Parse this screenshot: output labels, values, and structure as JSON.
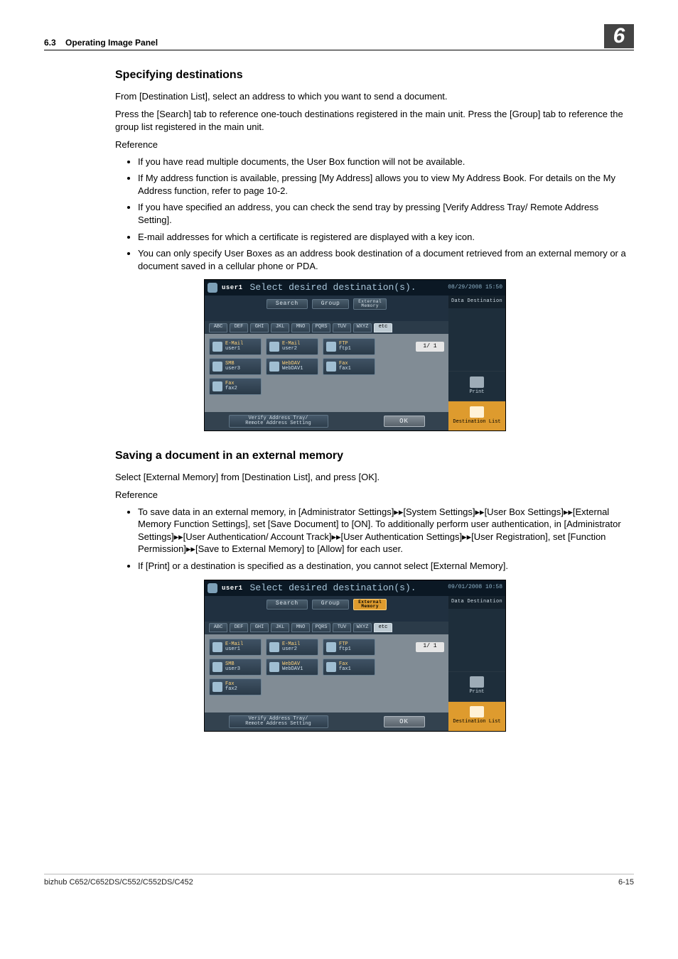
{
  "header": {
    "section_num": "6.3",
    "section_title": "Operating Image Panel",
    "chapter_num": "6"
  },
  "sec1": {
    "heading": "Specifying destinations",
    "p1": "From [Destination List], select an address to which you want to send a document.",
    "p2": "Press the [Search] tab to reference one-touch destinations registered in the main unit. Press the [Group] tab to reference the group list registered in the main unit.",
    "ref": "Reference",
    "bullets": [
      "If you have read multiple documents, the User Box function will not be available.",
      "If My address function is available, pressing [My Address] allows you to view My Address Book. For details on the My Address function, refer to page 10-2.",
      "If you have specified an address, you can check the send tray by pressing [Verify Address Tray/ Remote Address Setting].",
      "E-mail addresses for which a certificate is registered are displayed with a key icon.",
      "You can only specify User Boxes as an address book destination of a document retrieved from an external memory or a document saved in a cellular phone or PDA."
    ]
  },
  "sec2": {
    "heading": "Saving a document in an external memory",
    "p1": "Select [External Memory] from [Destination List], and press [OK].",
    "ref": "Reference",
    "bullets": [
      "To save data in an external memory, in [Administrator Settings]▸▸[System Settings]▸▸[User Box Settings]▸▸[External Memory Function Settings], set [Save Document] to [ON]. To additionally perform user authentication, in [Administrator Settings]▸▸[User Authentication/ Account Track]▸▸[User Authentication Settings]▸▸[User Registration], set [Function Permission]▸▸[Save to External Memory] to [Allow] for each user.",
      "If [Print] or a destination is specified as a destination, you cannot select [External Memory]."
    ]
  },
  "panel_common": {
    "user": "user1",
    "prompt": "Select desired destination(s).",
    "data_dest": "Data Destination",
    "search": "Search",
    "group": "Group",
    "ext_mem_top": "External",
    "ext_mem_bot": "Memory",
    "tabs": [
      "ABC",
      "DEF",
      "GHI",
      "JKL",
      "MNO",
      "PQRS",
      "TUV",
      "WXYZ",
      "etc"
    ],
    "pager": "1/  1",
    "verify_l1": "Verify Address Tray/",
    "verify_l2": "Remote Address Setting",
    "ok": "OK",
    "print": "Print",
    "dest_list": "Destination List",
    "rows": [
      [
        {
          "t": "E-Mail",
          "b": "user1"
        },
        {
          "t": "E-Mail",
          "b": "user2"
        },
        {
          "t": "FTP",
          "b": "ftp1"
        }
      ],
      [
        {
          "t": "SMB",
          "b": "user3"
        },
        {
          "t": "WebDAV",
          "b": "WebDAV1"
        },
        {
          "t": "Fax",
          "b": "fax1"
        }
      ],
      [
        {
          "t": "Fax",
          "b": "fax2"
        }
      ]
    ]
  },
  "panel1": {
    "datetime": "08/29/2008  15:50",
    "ext_selected": false
  },
  "panel2": {
    "datetime": "09/01/2008  10:58",
    "ext_selected": true
  },
  "footer": {
    "model": "bizhub C652/C652DS/C552/C552DS/C452",
    "page": "6-15"
  }
}
